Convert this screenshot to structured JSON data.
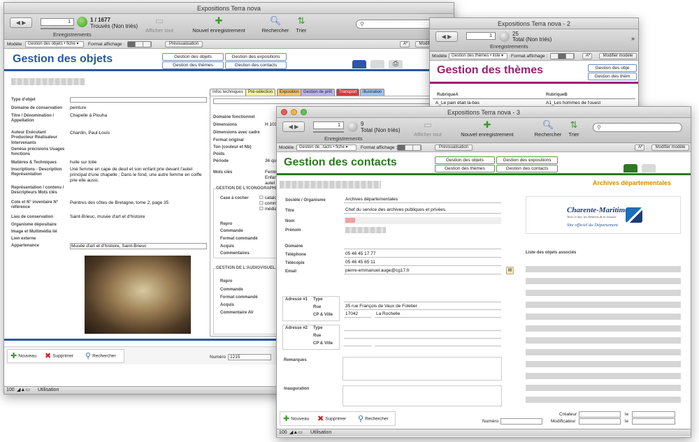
{
  "colors": {
    "objets_accent": "#2a57a6",
    "themes_accent": "#9b1f6e",
    "contacts_accent": "#2a7a1f",
    "archives_orange": "#d48a00",
    "transport_red": "#d23b3b"
  },
  "win1": {
    "title": "Expositions Terra nova",
    "record_index": "1",
    "found": "1 / 1677",
    "found_sub": "Trouvés (Non triés)",
    "records_label": "Enregistrements",
    "show_all": "Afficher tout",
    "new_record": "Nouvel enregistrement",
    "search": "Rechercher",
    "sort": "Trier",
    "model_label": "Modèle :",
    "model_value": "Gestion des objets • fiche ▾",
    "format_label": "Format affichage :",
    "preview": "Prévisualisation",
    "aa": "Aº",
    "modify_model": "Modifier modèle",
    "heading": "Gestion des objets",
    "nav": [
      "Gestion des objets",
      "Gestion des expositions",
      "Gestion des thèmes",
      "Gestion des contacts"
    ],
    "fields": {
      "type_objet": "Type d'objet",
      "domaine": "Domaine  de conservation",
      "domaine_val": "peinture",
      "titre": "Titre / Dénomination / Appellation",
      "titre_val": "Chapelle à Plouha",
      "auteur": "Auteur Exécutant Producteur Réalisateur",
      "auteur_val": "Chardin, Paul-Louis",
      "intervenants": "Intervenants",
      "genese": "Genèse précisions Usages fonctions",
      "matieres": "Matières & Techniques",
      "matieres_val": "huile sur toile",
      "inscriptions": "Inscriptions - Description Représentation",
      "inscriptions_val": "Une femme en cape de deuil et son enfant prie devant l'autel principal d'une chapelle ; Dans le fond, une autre femme en coiffe prie elle aussi.",
      "representation": "Représentation / contenu / Descripteurs Mots clés",
      "cote": "Cote et N° inventaire N° référence",
      "cote_val": "Peintres des côtes de Bretagne, tome 2, page 35",
      "lieu": "Lieu de conservation",
      "lieu_val": "Saint-Brieuc, musée d'art et d'histoire",
      "organisme": "Organisme dépositaire",
      "image": "Image et Multimédia lié",
      "lien": "Lien externe",
      "appartenance": "Appartenance",
      "appartenance_val": "Musée d'art et d'histoire, Saint-Brieuc"
    },
    "tabs": [
      "Infos techniques",
      "Pré-sélection",
      "Exposition",
      "Gestion de prêt",
      "Transport",
      "Illustration"
    ],
    "tech": {
      "domaine_fonc": "Domaine  fonctionnel",
      "dimensions": "Dimensions",
      "dimensions_val": "H 103",
      "dim_cadre": "Dimensions avec cadre",
      "format": "Format original",
      "ton": "Ton (couleur et Nb)",
      "poids": "Poids",
      "periode": "Période",
      "periode_val": "36 qu",
      "mots": "Mots clés",
      "mots_val": "Femm Enfan autel",
      "icono": "GESTION DE L'ICONOGRAPHIE",
      "case": "Case à cocher",
      "checks": [
        "catalogu",
        "comm",
        "médiati"
      ],
      "repro": "Repro",
      "commande": "Commande",
      "format_cmd": "Format commandé",
      "acquis": "Acquis",
      "commentaires": "Commentaires",
      "audio": "GESTION DE L'AUDIOVISUEL",
      "repro2": "Repro",
      "commande2": "Commande",
      "format_cmd2": "Format commandé",
      "acquis2": "Acquis",
      "comment_av": "Commentaire AV"
    },
    "actions": {
      "new": "Nouveau",
      "delete": "Supprimer",
      "search": "Rechercher",
      "numero": "Numéro",
      "numero_val": "1215"
    },
    "status": {
      "zoom": "100",
      "mode": "Utilisation"
    }
  },
  "win2": {
    "title": "Expositions Terra nova - 2",
    "record_index": "1",
    "count": "25",
    "count_sub": "Total (Non triés)",
    "records_label": "Enregistrements",
    "model_label": "Modèle :",
    "model_value": "Gestion des thèmes • liste ▾",
    "format_label": "Format affichage :",
    "aa": "Aº",
    "modify_model": "Modifier modèle",
    "heading": "Gestion des thèmes",
    "nav": [
      "Gestion des obje",
      "Gestion des thèm"
    ],
    "col_a": "RubriqueA",
    "col_b": "RubriqueB",
    "row_a": "A_Le pain était là-bas",
    "row_b": "A1_Les hommes de l'ouest"
  },
  "win3": {
    "title": "Expositions Terra nova - 3",
    "record_index": "1",
    "count": "9",
    "count_sub": "Total (Non triés)",
    "records_label": "Enregistrements",
    "show_all": "Afficher tout",
    "new_record": "Nouvel enregistrement",
    "search": "Rechercher",
    "sort": "Trier",
    "model_label": "Modèle :",
    "model_value": "Gestion de...tacts • fiche ▾",
    "format_label": "Format affichage :",
    "preview": "Prévisualisation",
    "aa": "Aº",
    "modify_model": "Modifier modèle",
    "heading": "Gestion des contacts",
    "nav": [
      "Gestion des objets",
      "Gestion des expositions",
      "Gestion des thèmes",
      "Gestion des contacts"
    ],
    "org_header": "Archives départementales",
    "fields": {
      "societe": "Société / Organisme",
      "societe_val": "Archives départementales",
      "titre": "Titre",
      "titre_val": "Chef du service des archives publiques et privées",
      "nom": "Nom",
      "prenom": "Prénom",
      "domaine": "Domaine",
      "telephone": "Téléphone",
      "telephone_val": "05 46 45 17 77",
      "telecopie": "Télécopie",
      "telecopie_val": "05 46 45 65 11",
      "email": "Email",
      "email_val": "pierre-emmanuel.auge@cg17.fr",
      "adresse1": "Adresse #1",
      "type": "Type",
      "rue": "Rue",
      "rue_val": "35 rue François de Vaux de Foletier",
      "cp": "CP & Ville",
      "cp_val": "17042",
      "ville_val": "La Rochelle",
      "adresse2": "Adresse #2",
      "remarques": "Remarques",
      "inauguration": "Inauguration"
    },
    "logo_name": "Charente-Maritime",
    "logo_tag": "Terre et mer, les éléments de la réussite",
    "logo_sub": "Site officiel du Département",
    "liste_label": "Liste des objets associés",
    "actions": {
      "new": "Nouveau",
      "delete": "Supprimer",
      "search": "Rechercher",
      "numero": "Numéro",
      "createur": "Créateur",
      "modificateur": "Modificateur",
      "le": "le"
    },
    "status": {
      "zoom": "100",
      "mode": "Utilisation"
    }
  }
}
